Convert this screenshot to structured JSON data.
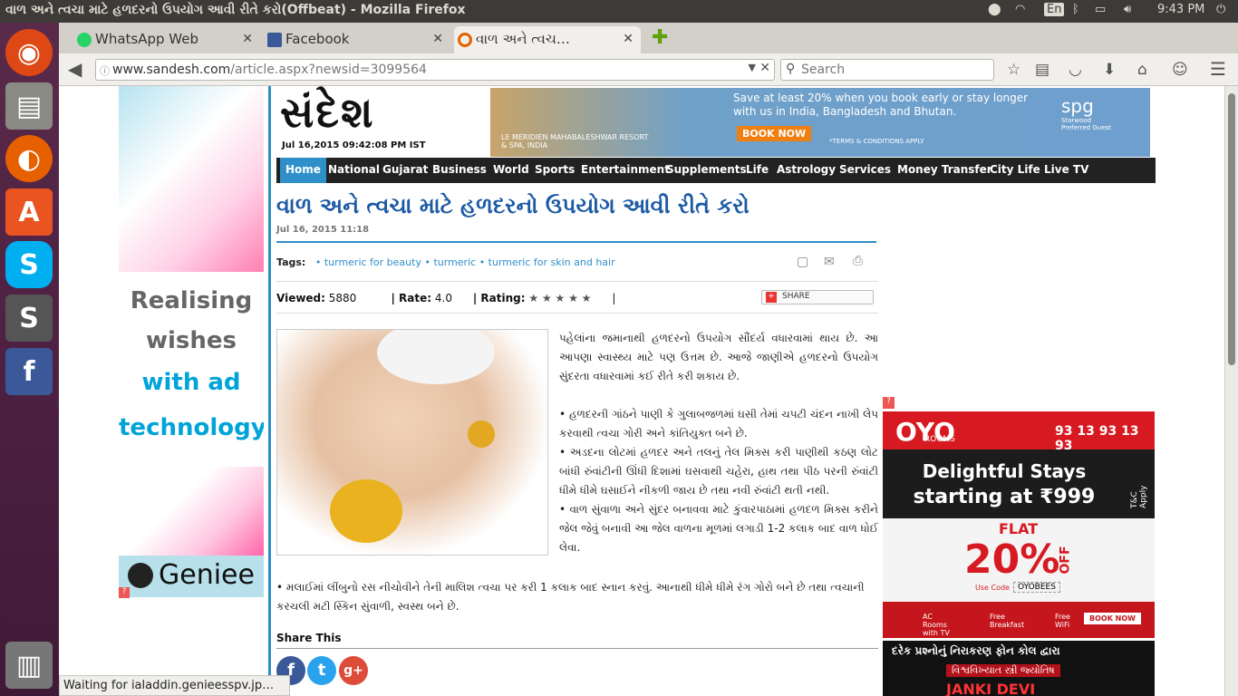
{
  "window": {
    "title": "વાળ અને ત્વચા માટે હળદરનો ઉપયોગ આવી રીતે કરો(Offbeat) - Mozilla Firefox"
  },
  "system": {
    "lang": "En",
    "time": "9:43 PM"
  },
  "tabs": [
    {
      "label": "WhatsApp Web"
    },
    {
      "label": "Facebook"
    },
    {
      "label": "વાળ અને ત્વચ…"
    }
  ],
  "nav": {
    "url_host": "www.sandesh.com",
    "url_path": "/article.aspx?newsid=3099564",
    "search_placeholder": "Search"
  },
  "left_ad": {
    "line1": "Realising",
    "line2": "wishes",
    "line3": "with ad",
    "line4": "technology",
    "brand": "Geniee"
  },
  "site": {
    "logo": "સંદેશ",
    "datestamp": "Jul 16,2015 09:42:08 PM IST",
    "top_ad": {
      "text": "Save at least 20% when you book early or stay longer with us in India, Bangladesh and Bhutan.",
      "button": "BOOK NOW",
      "terms": "*TERMS & CONDITIONS APPLY",
      "hotel": "LE MERIDIEN MAHABALESHWAR RESORT & SPA, INDIA",
      "brand": "spg",
      "brand_sub": "Starwood Preferred Guest"
    },
    "menu": [
      "Home",
      "National",
      "Gujarat",
      "Business",
      "World",
      "Sports",
      "Entertainment",
      "Supplements",
      "Life",
      "Astrology",
      "Services",
      "Money Transfer",
      "City Life",
      "Live TV"
    ]
  },
  "article": {
    "headline": "વાળ અને ત્વચા માટે હળદરનો ઉપયોગ આવી રીતે કરો",
    "date": "Jul 16, 2015 11:18",
    "tags_label": "Tags:",
    "tags": [
      "• turmeric for beauty",
      "• turmeric",
      "• turmeric for skin and hair"
    ],
    "viewed_label": "Viewed:",
    "viewed": "5880",
    "rate_label": "| Rate:",
    "rate": "4.0",
    "rating_label": "| Rating:",
    "stars": "★ ★ ★ ★ ★",
    "share_label": "SHARE",
    "intro": "પહેલાંના જમાનાથી હળદરનો ઉપયોગ સૌંદર્ય વધારવામાં થાય છે. આ આપણા સ્વાસ્થ્ય માટે પણ ઉત્તમ છે. આજે જાણીએ હળદરનો ઉપયોગ સુંદરતા વધારવામાં કઈ રીતે કરી શકાય છે.",
    "bullets": [
      "હળદરની ગાંઠને પાણી કે ગુલાબજળમાં ઘસી તેમાં ચપટી ચંદન નાખી લેપ કરવાથી ત્વચા ગોરી અને કાંતિયુક્ત બને છે.",
      "અડદના લોટમાં હળદર અને તલનું તેલ મિક્સ કરી પાણીથી કઠણ લોટ બાંધી રુંવાંટીની ઊંધી દિશામાં ઘસવાથી ચહેરા, હાથ તથા પીઠ પરની રુંવાંટી ધીમે ધીમે ઘસાઈને નીકળી જાય છે તથા નવી રુંવાંટી થતી નથી.",
      "વાળ સુંવાળા અને સુંદર બનાવવા માટે કુંવારપાઠામાં હળદળ મિક્સ કરીને જેલ જેવું બનાવી આ જેલ વાળના મૂળમાં લગાડી 1-2 કલાક બાદ વાળ ધોઈ લેવા."
    ],
    "bullet_wide": "મલાઈમાં લીંબુનો રસ નીચોવીને તેની માલિશ ત્વચા પર કરી 1 કલાક બાદ સ્નાન કરવું. આનાથી ધીમે ધીમે રંગ ગોરો બને છે તથા ત્વચાની કરચલી મટી સ્કિન સુંવાળી, સ્વસ્થ બને છે.",
    "share_this": "Share This"
  },
  "right_ad": {
    "brand": "OYO",
    "brand_sub": "ROOMS",
    "phone": "93 13 93 13 93",
    "line1": "Delightful Stays",
    "line2": "starting at ₹999",
    "tc": "T&C Apply",
    "flat": "FLAT",
    "percent": "20%",
    "off": "OFF",
    "code_label": "Use Code",
    "code": "OYOBEES",
    "features": [
      "AC Rooms with TV",
      "Free Breakfast",
      "Free WiFi"
    ],
    "book": "BOOK NOW"
  },
  "astro_ad": {
    "line1": "દરેક પ્રશ્નોનું નિરાકરણ ફોન કોલ દ્વારા",
    "line2": "વિશ્વવિખ્યાત સ્ત્રી જ્યોતિષ",
    "name": "JANKI DEVI"
  },
  "status": "Waiting for ialaddin.genieesspv.jp…",
  "colors": {
    "accent": "#2f8fc9",
    "headline": "#1c5aa4",
    "menu_bg": "#222222",
    "oyo_red": "#d71a21"
  }
}
